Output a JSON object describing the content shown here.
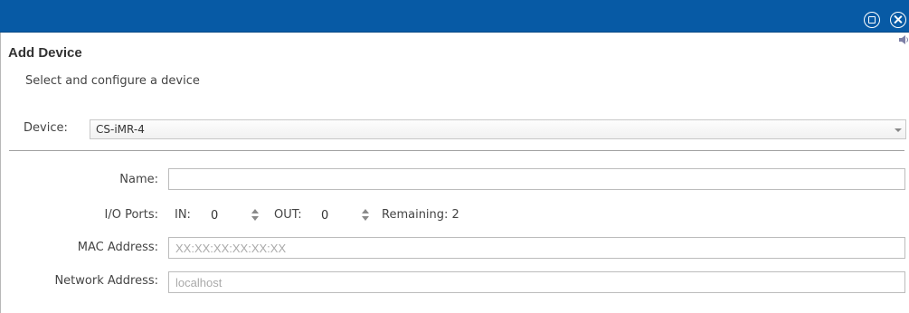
{
  "window": {
    "restore_icon": "restore-icon",
    "close_icon": "close-icon",
    "title_bar_color": "#075aa5"
  },
  "dialog": {
    "title": "Add Device",
    "subtitle": "Select and configure a device"
  },
  "device": {
    "label": "Device:",
    "selected": "CS-iMR-4"
  },
  "form": {
    "name": {
      "label": "Name:",
      "value": "",
      "placeholder": ""
    },
    "io_ports": {
      "label": "I/O Ports:",
      "in_label": "IN:",
      "in_value": "0",
      "out_label": "OUT:",
      "out_value": "0",
      "remaining_label": "Remaining: 2"
    },
    "mac": {
      "label": "MAC Address:",
      "value": "",
      "placeholder": "XX:XX:XX:XX:XX:XX"
    },
    "network": {
      "label": "Network Address:",
      "value": "",
      "placeholder": "localhost"
    }
  }
}
